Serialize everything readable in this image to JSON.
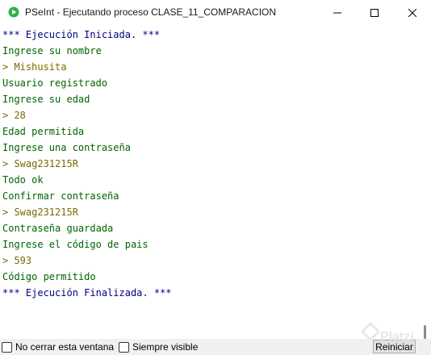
{
  "window": {
    "title": "PSeInt - Ejecutando proceso CLASE_11_COMPARACION"
  },
  "console": {
    "lines": [
      {
        "text": "*** Ejecución Iniciada. ***",
        "kind": "system"
      },
      {
        "text": "Ingrese su nombre",
        "kind": "output"
      },
      {
        "text": "> Mishusita",
        "kind": "input"
      },
      {
        "text": "Usuario registrado",
        "kind": "output"
      },
      {
        "text": "Ingrese su edad",
        "kind": "output"
      },
      {
        "text": "> 28",
        "kind": "input"
      },
      {
        "text": "Edad permitida",
        "kind": "output"
      },
      {
        "text": "Ingrese una contraseña",
        "kind": "output"
      },
      {
        "text": "> Swag231215R",
        "kind": "input"
      },
      {
        "text": "Todo ok",
        "kind": "output"
      },
      {
        "text": "Confirmar contraseña",
        "kind": "output"
      },
      {
        "text": "> Swag231215R",
        "kind": "input"
      },
      {
        "text": "Contraseña guardada",
        "kind": "output"
      },
      {
        "text": "Ingrese el código de pais",
        "kind": "output"
      },
      {
        "text": "> 593",
        "kind": "input"
      },
      {
        "text": "Código permitido",
        "kind": "output"
      },
      {
        "text": "*** Ejecución Finalizada. ***",
        "kind": "system"
      }
    ]
  },
  "bottom": {
    "no_cerrar_label": "No cerrar esta ventana",
    "no_cerrar_checked": false,
    "siempre_visible_label": "Siempre visible",
    "siempre_visible_checked": false,
    "reiniciar_label": "Reiniciar"
  },
  "watermark": {
    "text": "Platzi"
  },
  "colors": {
    "system": "#000080",
    "output": "#006400",
    "input": "#7a6a00",
    "icon_green": "#2db34a"
  }
}
